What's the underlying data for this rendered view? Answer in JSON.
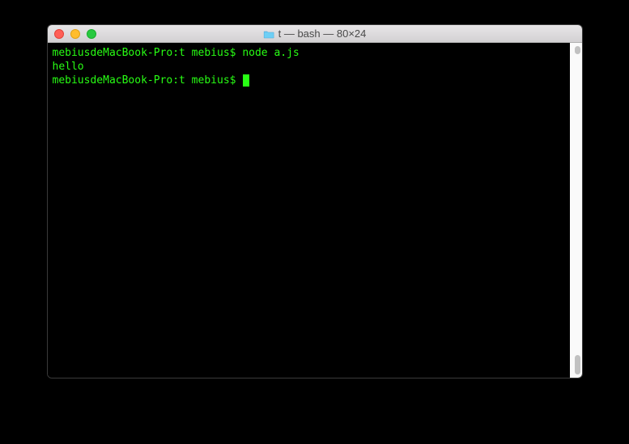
{
  "window": {
    "title": "t — bash — 80×24",
    "folder_icon": "folder"
  },
  "traffic": {
    "close": "close",
    "minimize": "minimize",
    "maximize": "maximize"
  },
  "terminal": {
    "lines": [
      {
        "prompt": "mebiusdeMacBook-Pro:t mebius$ ",
        "command": "node a.js"
      },
      {
        "output": "hello"
      },
      {
        "prompt": "mebiusdeMacBook-Pro:t mebius$ ",
        "command": "",
        "cursor": true
      }
    ],
    "text_color": "#28fe14",
    "background": "#000000"
  }
}
